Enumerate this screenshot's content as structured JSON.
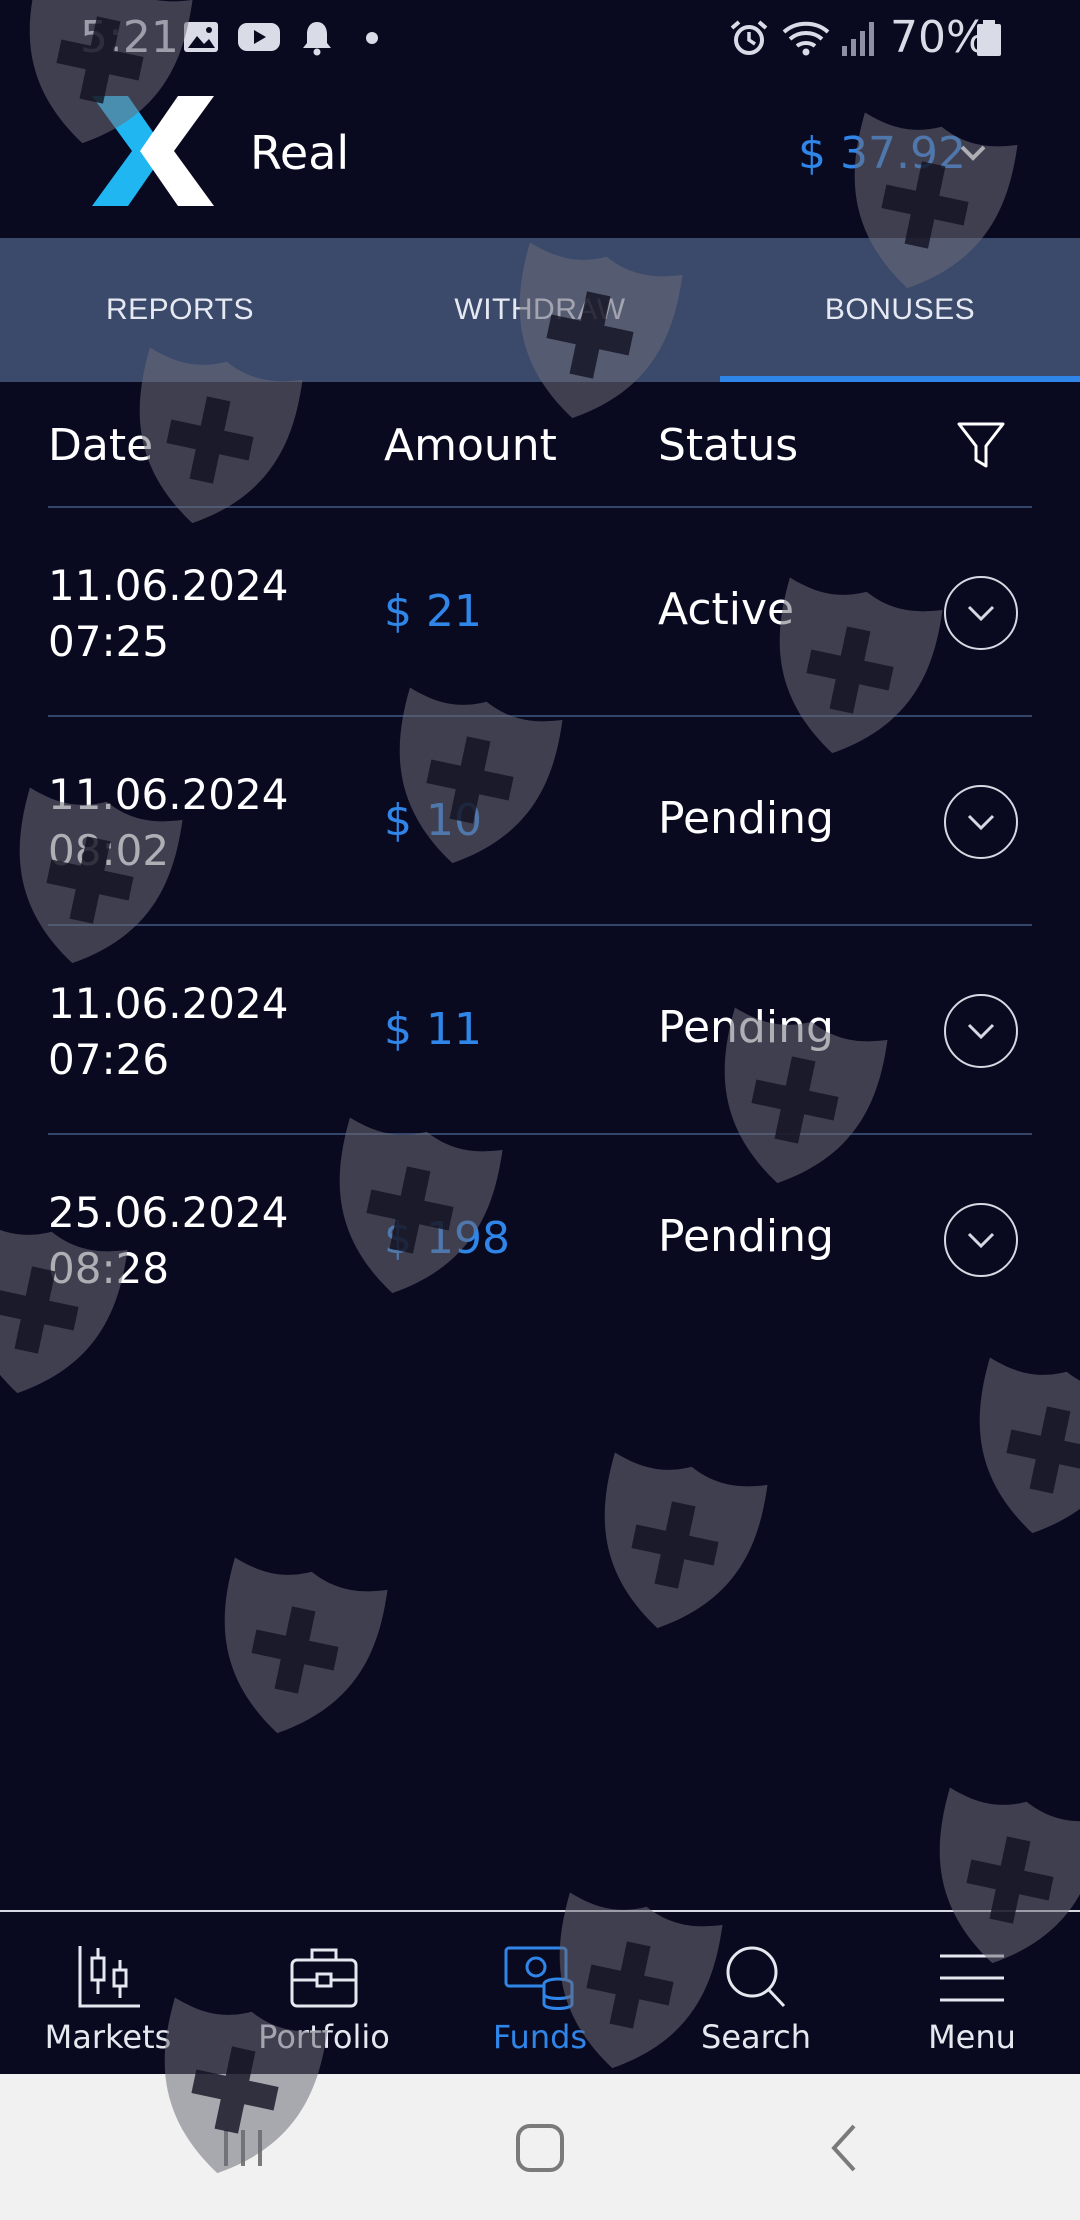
{
  "status_bar": {
    "time": "5:21",
    "battery_percent": "70%",
    "icons": [
      "image-icon",
      "youtube-icon",
      "notification-bell-icon",
      "dot-icon",
      "alarm-icon",
      "wifi-icon",
      "signal-icon",
      "battery-icon"
    ]
  },
  "header": {
    "account_type": "Real",
    "balance": "$ 37.92"
  },
  "tabs": [
    {
      "label": "REPORTS",
      "active": false
    },
    {
      "label": "WITHDRAW",
      "active": false
    },
    {
      "label": "BONUSES",
      "active": true
    }
  ],
  "table": {
    "columns": {
      "date": "Date",
      "amount": "Amount",
      "status": "Status"
    },
    "rows": [
      {
        "date": "11.06.2024",
        "time": "07:25",
        "amount": "$ 21",
        "status": "Active"
      },
      {
        "date": "11.06.2024",
        "time": "08:02",
        "amount": "$ 10",
        "status": "Pending"
      },
      {
        "date": "11.06.2024",
        "time": "07:26",
        "amount": "$ 11",
        "status": "Pending"
      },
      {
        "date": "25.06.2024",
        "time": "08:28",
        "amount": "$ 198",
        "status": "Pending"
      }
    ]
  },
  "bottom_nav": [
    {
      "label": "Markets",
      "icon": "candlestick-chart-icon",
      "active": false
    },
    {
      "label": "Portfolio",
      "icon": "briefcase-icon",
      "active": false
    },
    {
      "label": "Funds",
      "icon": "money-stack-icon",
      "active": true
    },
    {
      "label": "Search",
      "icon": "search-icon",
      "active": false
    },
    {
      "label": "Menu",
      "icon": "hamburger-menu-icon",
      "active": false
    }
  ],
  "colors": {
    "background": "#090a20",
    "tab_bar": "#3b4a6b",
    "accent": "#2f86e8",
    "divider": "#34456a",
    "system_nav": "#f1f1f1"
  }
}
